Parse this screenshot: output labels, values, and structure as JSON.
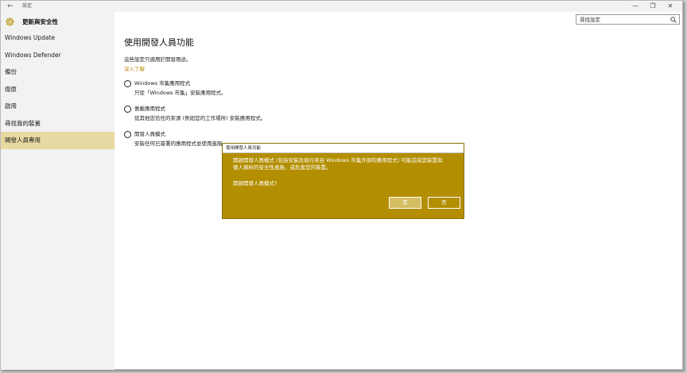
{
  "window": {
    "title": "設定",
    "back_glyph": "←",
    "controls": {
      "minimize": "—",
      "maximize": "❐",
      "close": "✕"
    }
  },
  "app": {
    "title": "更新與安全性",
    "accent_color": "#b38e00"
  },
  "search": {
    "placeholder": "尋找設定"
  },
  "sidebar": {
    "items": [
      {
        "label": "Windows Update"
      },
      {
        "label": "Windows Defender"
      },
      {
        "label": "備份"
      },
      {
        "label": "復原"
      },
      {
        "label": "啟用"
      },
      {
        "label": "尋找我的裝置"
      },
      {
        "label": "開發人員專用",
        "selected": true
      }
    ]
  },
  "main": {
    "title": "使用開發人員功能",
    "description": "這些設定只適用於開發用途。",
    "learn_more": "深入了解",
    "options": [
      {
        "title": "Windows 市集應用程式",
        "description": "只從「Windows 市集」安裝應用程式。"
      },
      {
        "title": "側載應用程式",
        "description": "從其他您信任的來源 (例如您的工作場所) 安裝應用程式。"
      },
      {
        "title": "開發人員模式",
        "description": "安裝任何已簽署的應用程式並使用進階"
      }
    ]
  },
  "dialog": {
    "title": "使用開發人員功能",
    "message_line1": "開啟開發人員模式 (包括安裝及執行來自 Windows 市集外部的應用程式) 可能造成您裝置與",
    "message_line2": "個人資料的安全性風險，或危害您的裝置。",
    "question": "開啟開發人員模式?",
    "yes_label": "是",
    "no_label": "否",
    "background_color": "#b38e00"
  }
}
